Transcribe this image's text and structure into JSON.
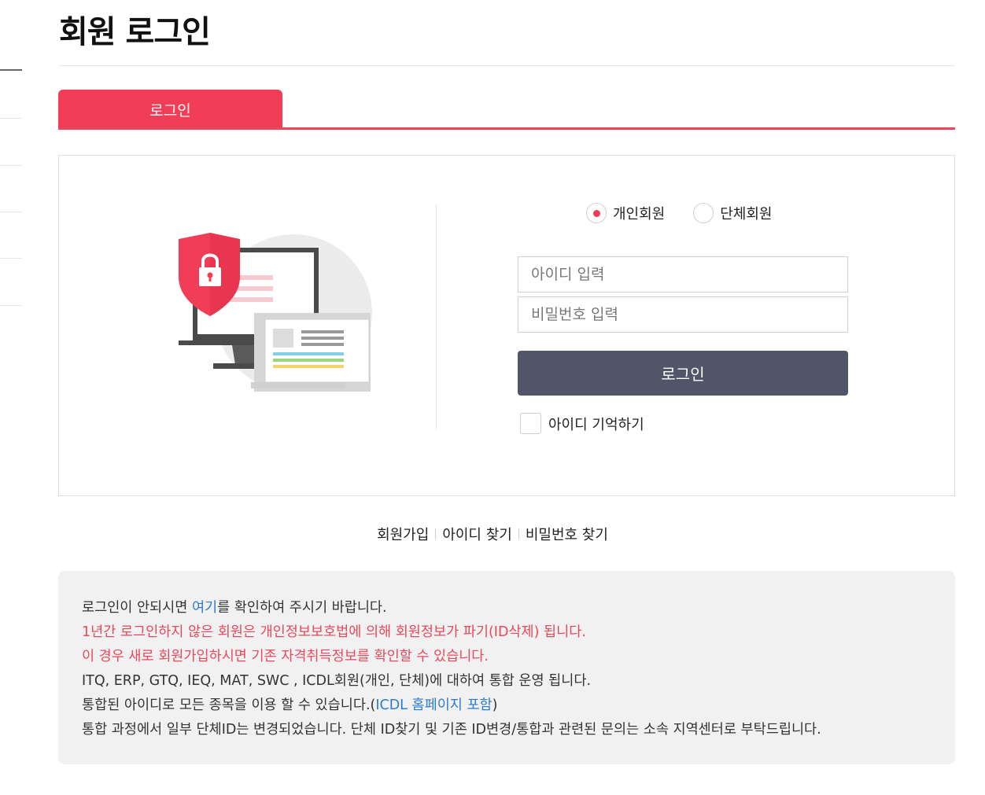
{
  "page_title": "회원 로그인",
  "tab": {
    "label": "로그인"
  },
  "member_type": {
    "options": [
      {
        "label": "개인회원",
        "selected": true
      },
      {
        "label": "단체회원",
        "selected": false
      }
    ]
  },
  "form": {
    "id_placeholder": "아이디 입력",
    "pw_placeholder": "비밀번호 입력",
    "login_button": "로그인",
    "remember_label": "아이디 기억하기"
  },
  "links": {
    "signup": "회원가입",
    "find_id": "아이디 찾기",
    "find_pw": "비밀번호 찾기"
  },
  "notice": {
    "line1_pre": "로그인이 안되시면 ",
    "line1_link": "여기",
    "line1_post": "를 확인하여 주시기 바랍니다.",
    "line2": "1년간 로그인하지 않은 회원은 개인정보보호법에 의해 회원정보가 파기(ID삭제) 됩니다.",
    "line3": "이 경우 새로 회원가입하시면 기존 자격취득정보를 확인할 수 있습니다.",
    "line4": "ITQ, ERP, GTQ, IEQ, MAT, SWC , ICDL회원(개인, 단체)에 대하여 통합 운영 됩니다.",
    "line5_pre": "통합된 아이디로 모든 종목을 이용 할 수 있습니다.(",
    "line5_link": "ICDL 홈페이지 포함",
    "line5_post": ")",
    "line6": "통합 과정에서 일부 단체ID는 변경되었습니다. 단체 ID찾기 및 기존 ID변경/통합과 관련된 문의는 소속 지역센터로 부탁드립니다."
  },
  "colors": {
    "accent": "#f23d57",
    "button": "#505567",
    "link": "#2b7bd2",
    "notice_red": "#e8485c"
  }
}
